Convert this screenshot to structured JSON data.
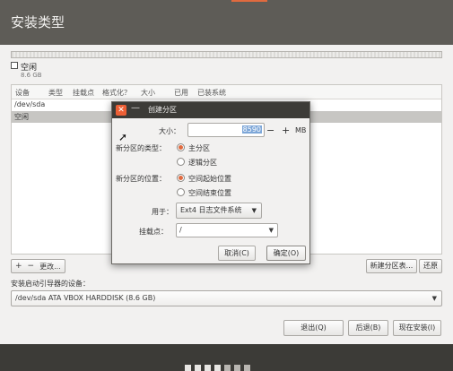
{
  "window": {
    "title": "安装类型"
  },
  "partition_bar": {
    "legend_name": "空闲",
    "legend_size": "8.6 GB"
  },
  "table": {
    "columns": [
      "设备",
      "类型",
      "挂载点",
      "格式化？",
      "大小",
      "已用",
      "已装系统"
    ],
    "rows": [
      {
        "label": "/dev/sda",
        "selected": false
      },
      {
        "label": "空闲",
        "selected": true
      }
    ]
  },
  "table_buttons": {
    "add": "+",
    "remove": "−",
    "change": "更改..."
  },
  "right_buttons": {
    "new_table": "新建分区表...",
    "revert": "还原"
  },
  "bootloader": {
    "label": "安装启动引导器的设备：",
    "value": "/dev/sda ATA VBOX HARDDISK (8.6 GB)"
  },
  "nav": {
    "quit": "退出(Q)",
    "back": "后退(B)",
    "install_now": "现在安装(I)"
  },
  "dialog": {
    "title": "创建分区",
    "size_label": "大小：",
    "size_value": "8590",
    "size_unit": "MB",
    "minus": "−",
    "plus": "+",
    "type_label": "新分区的类型：",
    "type_primary": "主分区",
    "type_logical": "逻辑分区",
    "location_label": "新分区的位置：",
    "location_start": "空间起始位置",
    "location_end": "空间结束位置",
    "use_label": "用于：",
    "use_value": "Ext4 日志文件系统",
    "mount_label": "挂载点：",
    "mount_value": "/",
    "cancel": "取消(C)",
    "ok": "确定(O)"
  }
}
